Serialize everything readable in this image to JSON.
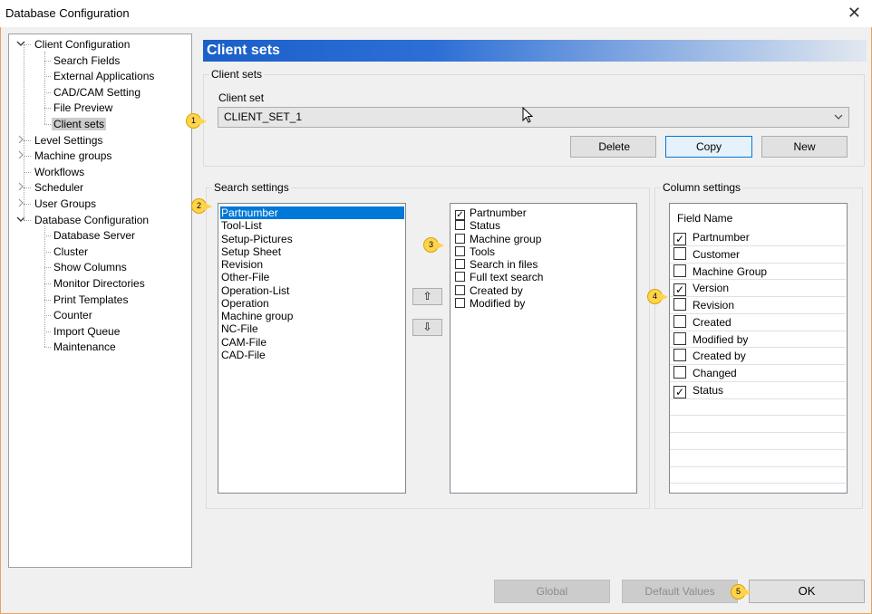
{
  "window": {
    "title": "Database Configuration",
    "close_glyph": "✕"
  },
  "tree": {
    "items": [
      {
        "label": "Client Configuration",
        "level": 0,
        "expander": "expanded"
      },
      {
        "label": "Search Fields",
        "level": 1
      },
      {
        "label": "External Applications",
        "level": 1
      },
      {
        "label": "CAD/CAM Setting",
        "level": 1
      },
      {
        "label": "File Preview",
        "level": 1
      },
      {
        "label": "Client sets",
        "level": 1,
        "selected": true
      },
      {
        "label": "Level Settings",
        "level": 0,
        "expander": "collapsed"
      },
      {
        "label": "Machine groups",
        "level": 0,
        "expander": "collapsed"
      },
      {
        "label": "Workflows",
        "level": 0,
        "expander": "none"
      },
      {
        "label": "Scheduler",
        "level": 0,
        "expander": "collapsed"
      },
      {
        "label": "User Groups",
        "level": 0,
        "expander": "collapsed"
      },
      {
        "label": "Database Configuration",
        "level": 0,
        "expander": "expanded"
      },
      {
        "label": "Database Server",
        "level": 1
      },
      {
        "label": "Cluster",
        "level": 1
      },
      {
        "label": "Show Columns",
        "level": 1
      },
      {
        "label": "Monitor Directories",
        "level": 1
      },
      {
        "label": "Print Templates",
        "level": 1
      },
      {
        "label": "Counter",
        "level": 1
      },
      {
        "label": "Import Queue",
        "level": 1
      },
      {
        "label": "Maintenance",
        "level": 1
      }
    ]
  },
  "header": {
    "title": "Client sets"
  },
  "client_sets": {
    "group_title": "Client sets",
    "field_label": "Client set",
    "selected_value": "CLIENT_SET_1",
    "delete_label": "Delete",
    "copy_label": "Copy",
    "new_label": "New"
  },
  "search_settings": {
    "group_title": "Search settings",
    "fields": [
      "Partnumber",
      "Tool-List",
      "Setup-Pictures",
      "Setup Sheet",
      "Revision",
      "Other-File",
      "Operation-List",
      "Operation",
      "Machine group",
      "NC-File",
      "CAM-File",
      "CAD-File"
    ],
    "selected_index": 0,
    "options": [
      {
        "label": "Partnumber",
        "checked": true
      },
      {
        "label": "Status",
        "checked": false
      },
      {
        "label": "Machine group",
        "checked": false
      },
      {
        "label": "Tools",
        "checked": false
      },
      {
        "label": "Search in files",
        "checked": false
      },
      {
        "label": "Full text search",
        "checked": false
      },
      {
        "label": "Created by",
        "checked": false
      },
      {
        "label": "Modified by",
        "checked": false
      }
    ],
    "move_up_glyph": "⇧",
    "move_down_glyph": "⇩"
  },
  "column_settings": {
    "group_title": "Column settings",
    "header": "Field Name",
    "rows": [
      {
        "label": "Partnumber",
        "checked": true
      },
      {
        "label": "Customer",
        "checked": false
      },
      {
        "label": "Machine Group",
        "checked": false
      },
      {
        "label": "Version",
        "checked": true
      },
      {
        "label": "Revision",
        "checked": false
      },
      {
        "label": "Created",
        "checked": false
      },
      {
        "label": "Modified by",
        "checked": false
      },
      {
        "label": "Created by",
        "checked": false
      },
      {
        "label": "Changed",
        "checked": false
      },
      {
        "label": "Status",
        "checked": true
      }
    ],
    "empty_rows": 5
  },
  "footer": {
    "global_label": "Global",
    "default_values_label": "Default Values",
    "ok_label": "OK"
  },
  "badges": [
    "1",
    "2",
    "3",
    "4",
    "5"
  ],
  "colors": {
    "accent": "#0078d7",
    "header_start": "#1b5fc9",
    "badge": "#ffd44d"
  },
  "checkmark": "✓"
}
